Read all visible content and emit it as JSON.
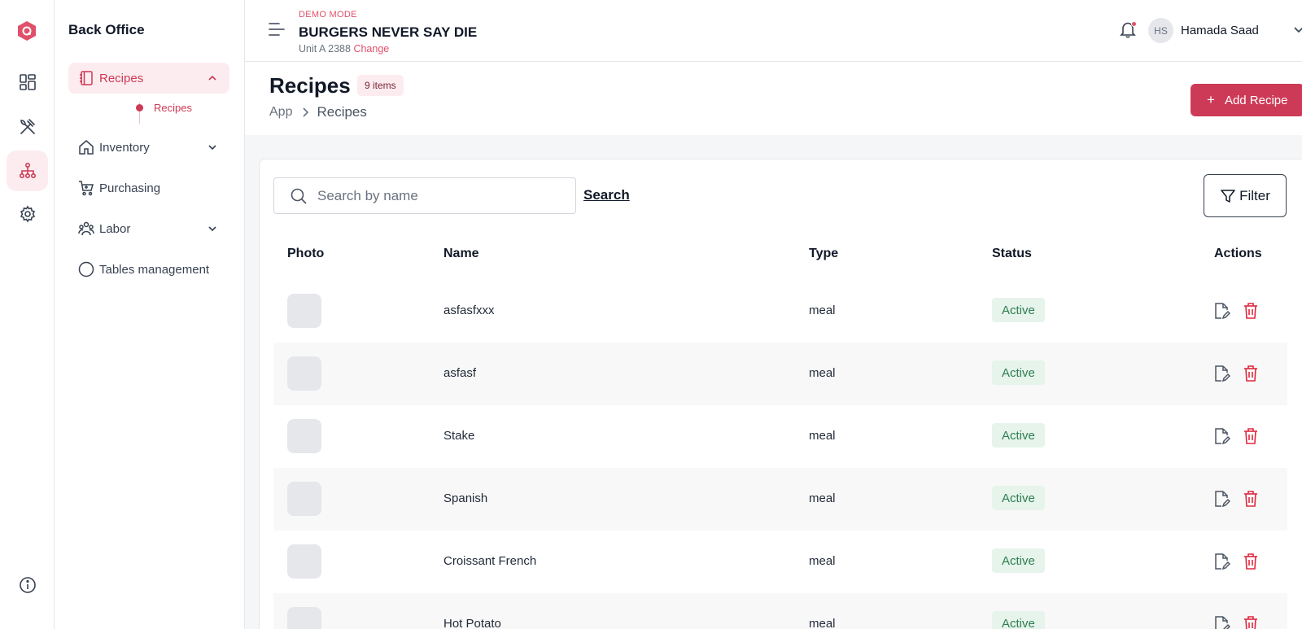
{
  "sidebar": {
    "title": "Back Office",
    "items": [
      {
        "label": "Recipes",
        "icon": "notebook-icon",
        "expanded": true
      },
      {
        "label": "Inventory",
        "icon": "home-icon"
      },
      {
        "label": "Purchasing",
        "icon": "cart-icon"
      },
      {
        "label": "Labor",
        "icon": "users-icon"
      },
      {
        "label": "Tables management",
        "icon": "circle-icon"
      }
    ],
    "subitems": [
      {
        "label": "Recipes"
      }
    ]
  },
  "header": {
    "demo_label": "DEMO MODE",
    "brand": "BURGERS NEVER SAY DIE",
    "unit": "Unit A 2388",
    "change_label": "Change",
    "user_initials": "HS",
    "user_name": "Hamada Saad"
  },
  "page": {
    "title": "Recipes",
    "count_badge": "9 items",
    "breadcrumb": [
      "App",
      "Recipes"
    ],
    "add_label": "Add Recipe"
  },
  "toolbar": {
    "search_placeholder": "Search by name",
    "search_label": "Search",
    "filter_label": "Filter"
  },
  "table": {
    "columns": [
      "Photo",
      "Name",
      "Type",
      "Status",
      "Actions"
    ],
    "rows": [
      {
        "name": "asfasfxxx",
        "type": "meal",
        "status": "Active"
      },
      {
        "name": "asfasf",
        "type": "meal",
        "status": "Active"
      },
      {
        "name": "Stake",
        "type": "meal",
        "status": "Active"
      },
      {
        "name": "Spanish",
        "type": "meal",
        "status": "Active"
      },
      {
        "name": "Croissant French",
        "type": "meal",
        "status": "Active"
      },
      {
        "name": "Hot Potato",
        "type": "meal",
        "status": "Active"
      }
    ]
  },
  "colors": {
    "accent": "#cd3a57",
    "accent_soft": "#fdecef",
    "status_bg": "#e6f4ec",
    "status_text": "#2e7d4f"
  }
}
